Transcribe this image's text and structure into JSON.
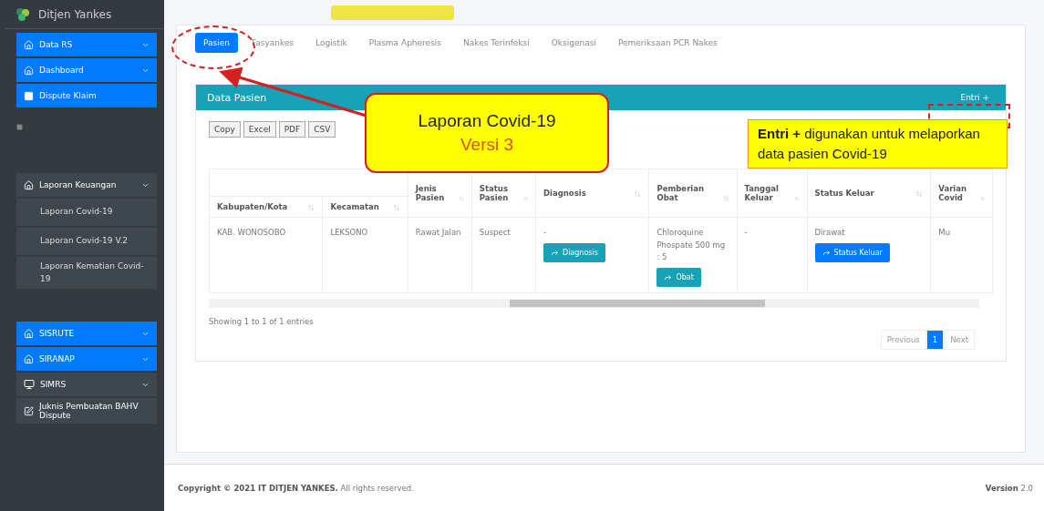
{
  "brand": {
    "title": "Ditjen Yankes"
  },
  "sidebar": {
    "items": [
      {
        "label": "Data RS",
        "kind": "group",
        "highlighted": true,
        "caret": true
      },
      {
        "label": "Dashboard",
        "kind": "group",
        "highlighted": true,
        "caret": true
      },
      {
        "label": "Dispute Klaim",
        "kind": "page",
        "highlighted": true,
        "caret": false
      },
      {
        "kind": "small"
      },
      {
        "label": "Laporan Keuangan",
        "kind": "group",
        "highlighted": false,
        "caret": true,
        "children": [
          {
            "label": "Laporan Covid-19",
            "kind": "sub"
          },
          {
            "label": "Laporan Covid-19 V.2",
            "kind": "sub"
          },
          {
            "label": "Laporan Kematian Covid-19",
            "kind": "sub"
          }
        ]
      },
      {
        "kind": "gap"
      },
      {
        "label": "SISRUTE",
        "kind": "group",
        "highlighted": true,
        "caret": true
      },
      {
        "label": "SIRANAP",
        "kind": "group",
        "highlighted": true,
        "caret": true
      },
      {
        "label": "SIMRS",
        "kind": "monitor",
        "highlighted": false,
        "caret": true
      },
      {
        "label": "Juknis Pembuatan BAHV Dispute",
        "kind": "edit",
        "highlighted": false,
        "caret": false
      }
    ]
  },
  "tabs": [
    {
      "label": "Pasien",
      "selected": true
    },
    {
      "label": "Fasyankes",
      "selected": false
    },
    {
      "label": "Logistik",
      "selected": false
    },
    {
      "label": "Plasma Apheresis",
      "selected": false
    },
    {
      "label": "Nakes Terinfeksi",
      "selected": false
    },
    {
      "label": "Oksigenasi",
      "selected": false
    },
    {
      "label": "Pemeriksaan PCR Nakes",
      "selected": false
    }
  ],
  "card": {
    "title": "Data Pasien",
    "entry_button": "Entri +"
  },
  "export_buttons": [
    "Copy",
    "Excel",
    "PDF",
    "CSV"
  ],
  "table": {
    "columns": [
      "Kabupaten/Kota",
      "Kecamatan",
      "Jenis Pasien",
      "Status Pasien",
      "Diagnosis",
      "Pemberian Obat",
      "Tanggal Keluar",
      "Status Keluar",
      "Varian Covid"
    ],
    "rows": [
      [
        {
          "text": "KAB. WONOSOBO"
        },
        {
          "text": "LEKSONO"
        },
        {
          "text": "Rawat Jalan"
        },
        {
          "text": "Suspect"
        },
        {
          "text": "-",
          "button": "Diagnosis",
          "color": "#17a2b8"
        },
        {
          "text": "Chloroquine Phospate 500 mg : 5",
          "button": "Obat",
          "color": "#17a2b8"
        },
        {
          "text": "-"
        },
        {
          "text": "Dirawat",
          "button": "Status Keluar",
          "color": "#007bff"
        },
        {
          "text": "Mu"
        }
      ]
    ]
  },
  "info": "Showing 1 to 1 of 1 entries",
  "pagination": [
    {
      "label": "Previous",
      "selected": false
    },
    {
      "label": "1",
      "selected": true
    },
    {
      "label": "Next",
      "selected": false
    }
  ],
  "footer": {
    "copyright": "**Copyright © 2021 IT DITJEN YANKES.** All rights reserved.",
    "version": "**Version** 2.0"
  },
  "callout": {
    "title": "Laporan Covid-19",
    "subtitle": "Versi 3"
  },
  "note": "**Entri +** digunakan untuk melaporkan data pasien Covid-19"
}
